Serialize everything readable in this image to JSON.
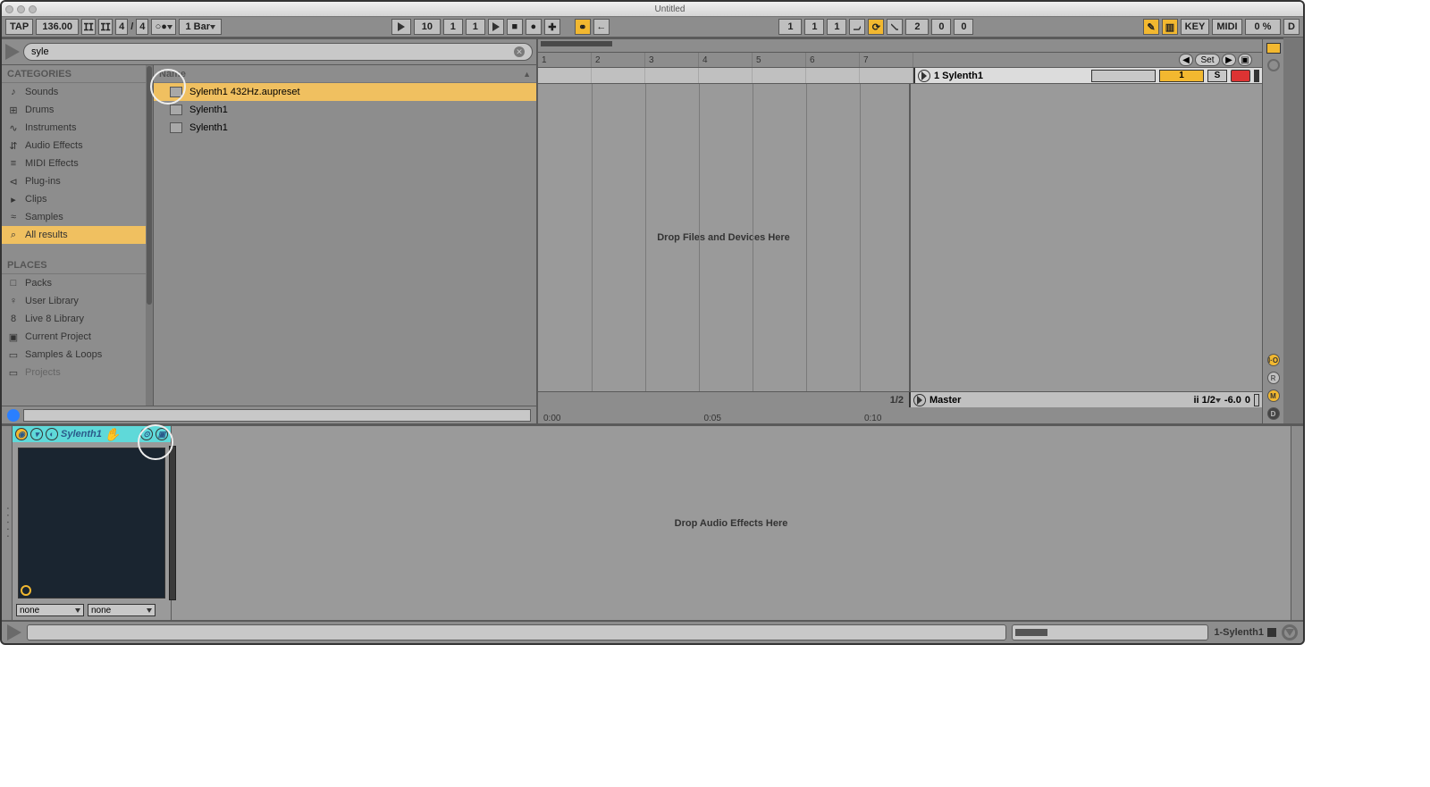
{
  "window": {
    "title": "Untitled"
  },
  "toolbar": {
    "tap": "TAP",
    "bpm": "136.00",
    "time_sig_num": "4",
    "time_sig_den": "4",
    "bar_label": "1 Bar",
    "pos1": "10",
    "pos2": "1",
    "pos3": "1",
    "loop_pos1": "1",
    "loop_pos2": "1",
    "loop_pos3": "1",
    "loop_len1": "2",
    "loop_len2": "0",
    "loop_len3": "0",
    "key_btn": "KEY",
    "midi_btn": "MIDI",
    "cpu": "0 %",
    "d_btn": "D"
  },
  "search": {
    "value": "syle"
  },
  "categories": {
    "header": "CATEGORIES",
    "items": [
      {
        "label": "Sounds",
        "glyph": "♪"
      },
      {
        "label": "Drums",
        "glyph": "⊞"
      },
      {
        "label": "Instruments",
        "glyph": "∿"
      },
      {
        "label": "Audio Effects",
        "glyph": "⇵"
      },
      {
        "label": "MIDI Effects",
        "glyph": "≡"
      },
      {
        "label": "Plug-ins",
        "glyph": "⊲"
      },
      {
        "label": "Clips",
        "glyph": "▸"
      },
      {
        "label": "Samples",
        "glyph": "≈"
      },
      {
        "label": "All results",
        "glyph": "⌕"
      }
    ]
  },
  "places": {
    "header": "PLACES",
    "items": [
      {
        "label": "Packs",
        "glyph": "□"
      },
      {
        "label": "User Library",
        "glyph": "♀"
      },
      {
        "label": "Live 8 Library",
        "glyph": "8"
      },
      {
        "label": "Current Project",
        "glyph": "▣"
      },
      {
        "label": "Samples & Loops",
        "glyph": "▭"
      },
      {
        "label": "Projects",
        "glyph": "▭"
      }
    ]
  },
  "results": {
    "header": "Name",
    "items": [
      {
        "label": "Sylenth1 432Hz.aupreset",
        "selected": true
      },
      {
        "label": "Sylenth1"
      },
      {
        "label": "Sylenth1"
      }
    ]
  },
  "arrangement": {
    "bars": [
      "1",
      "2",
      "3",
      "4",
      "5",
      "6",
      "7"
    ],
    "set_btn": "Set",
    "track_name": "1 Sylenth1",
    "track_send": "1",
    "solo": "S",
    "drop_hint": "Drop Files and Devices Here",
    "zoom": "1/2",
    "master": "Master",
    "master_select": "ii  1/2",
    "master_vol": "-6.0",
    "master_pan": "0",
    "times": [
      "0:00",
      "0:05",
      "0:10"
    ]
  },
  "io_panel": {
    "io": "I·O",
    "r": "R",
    "m": "M",
    "d": "D"
  },
  "device": {
    "name": "Sylenth1",
    "dd1": "none",
    "dd2": "none",
    "drop_hint": "Drop Audio Effects Here"
  },
  "status": {
    "track": "1-Sylenth1"
  }
}
